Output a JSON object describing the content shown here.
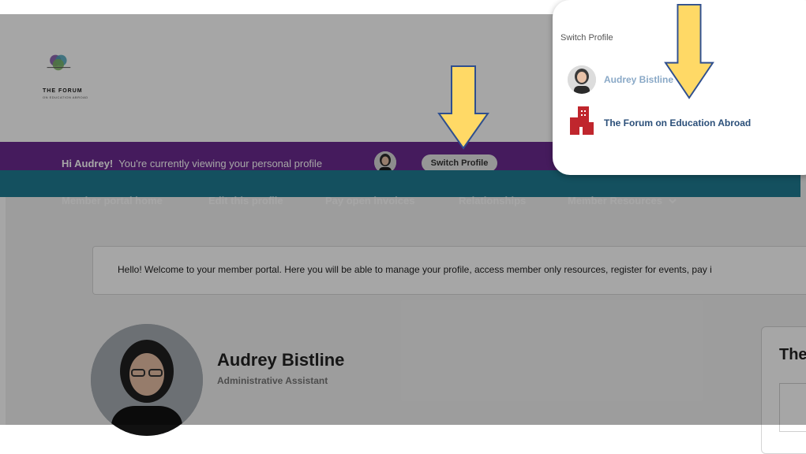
{
  "logo": {
    "line1": "THE FORUM",
    "line2": "ON EDUCATION ABROAD"
  },
  "greeting": {
    "hi": "Hi Audrey!",
    "text": "You're currently viewing your personal profile"
  },
  "switch_profile_button": "Switch Profile",
  "nav": {
    "items": [
      {
        "label": "Member portal home"
      },
      {
        "label": "Edit this profile"
      },
      {
        "label": "Pay open invoices"
      },
      {
        "label": "Relationships"
      },
      {
        "label": "Member Resources"
      }
    ]
  },
  "welcome": "Hello! Welcome to your member portal. Here you will be able to manage your profile, access member only resources, register for events, pay i",
  "profile": {
    "name": "Audrey Bistline",
    "role": "Administrative Assistant"
  },
  "side_card": {
    "title": "The"
  },
  "popup": {
    "title": "Switch Profile",
    "options": [
      {
        "label": "Audrey Bistline"
      },
      {
        "label": "The Forum on Education Abroad"
      }
    ]
  },
  "colors": {
    "purple": "#6a2a8f",
    "teal": "#1f7c93",
    "arrow_fill": "#ffd966",
    "arrow_stroke": "#2f4f8f",
    "brand_red": "#c0262d"
  }
}
